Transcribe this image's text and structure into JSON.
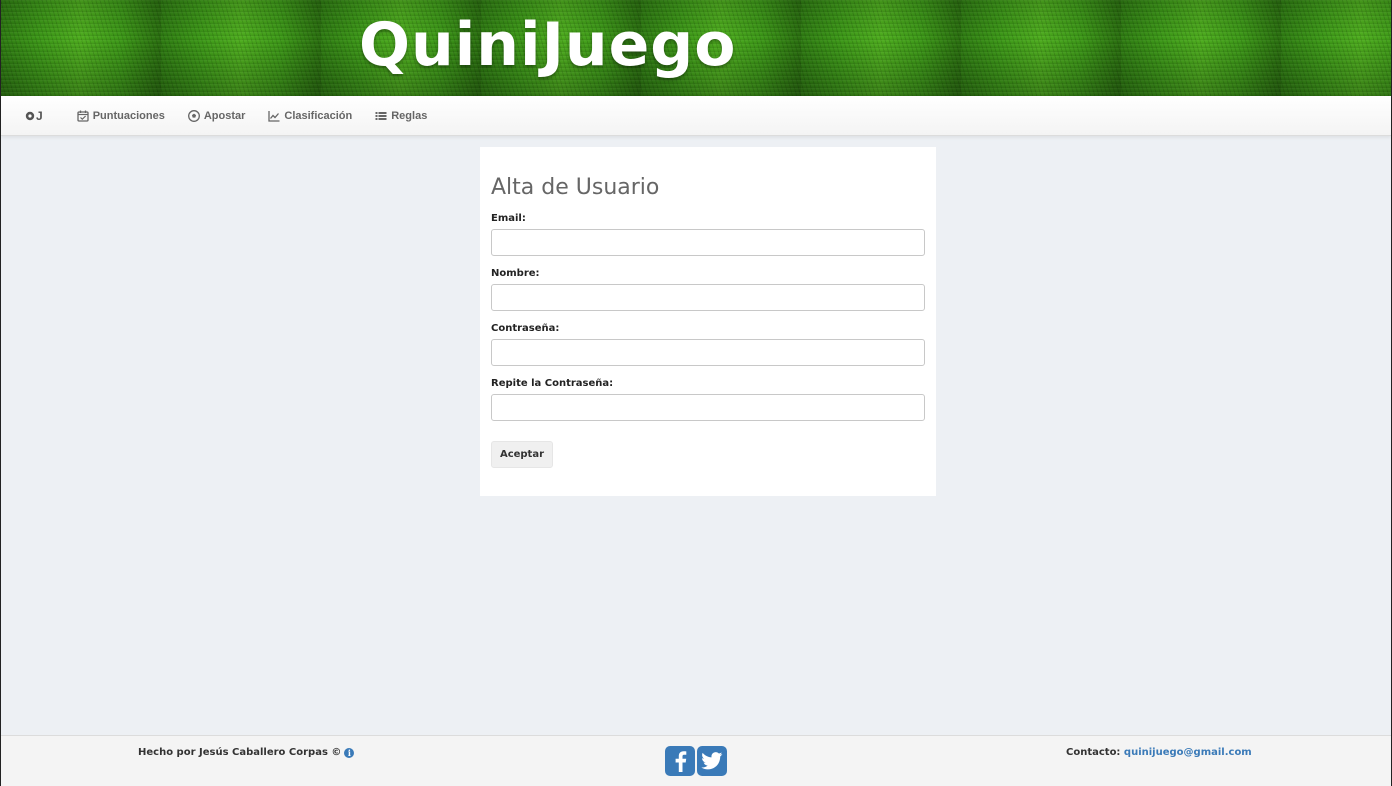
{
  "header": {
    "brand": "QuiniJuego"
  },
  "navbar": {
    "logo": "QJ",
    "items": [
      {
        "label": "Puntuaciones",
        "icon": "calendar-check-icon"
      },
      {
        "label": "Apostar",
        "icon": "soccer-ball-icon"
      },
      {
        "label": "Clasificación",
        "icon": "line-chart-icon"
      },
      {
        "label": "Reglas",
        "icon": "list-icon"
      }
    ]
  },
  "form": {
    "title": "Alta de Usuario",
    "fields": [
      {
        "label": "Email:",
        "value": ""
      },
      {
        "label": "Nombre:",
        "value": ""
      },
      {
        "label": "Contraseña:",
        "value": ""
      },
      {
        "label": "Repite la Contraseña:",
        "value": ""
      }
    ],
    "submit_label": "Aceptar"
  },
  "footer": {
    "credit": "Hecho por Jesús Caballero Corpas ©",
    "contact_label": "Contacto:",
    "contact_email": "quinijuego@gmail.com",
    "social": [
      "facebook-icon",
      "twitter-icon"
    ]
  },
  "colors": {
    "accent": "#3a7ab8",
    "background": "#edf0f4",
    "grass": "#3d9a18"
  }
}
